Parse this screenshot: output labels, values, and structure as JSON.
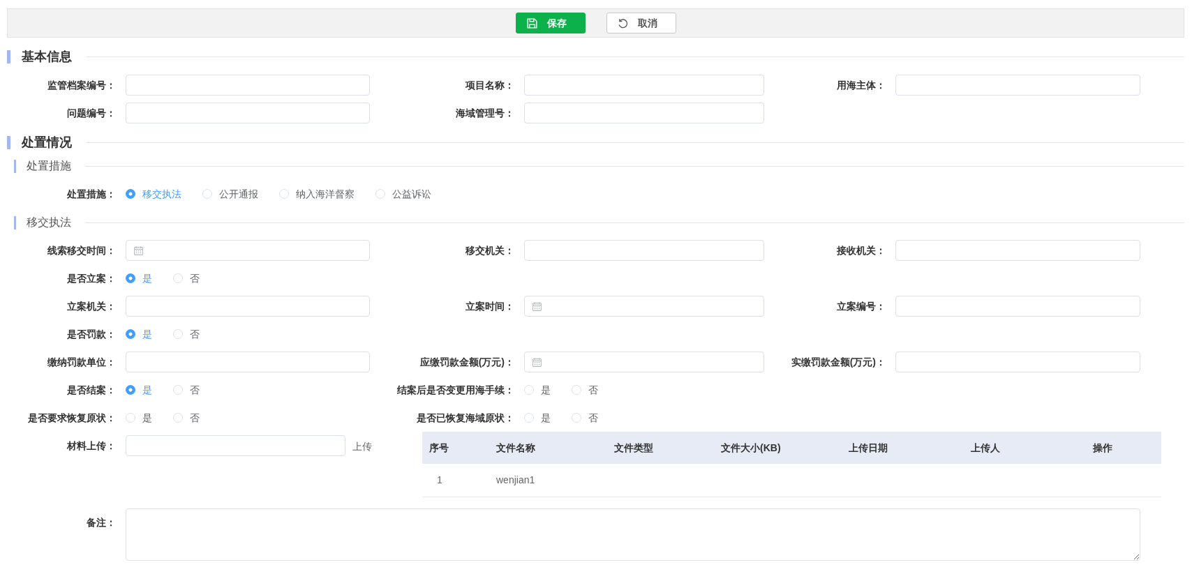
{
  "toolbar": {
    "buttons": [
      {
        "kind": "save",
        "label": "保存"
      },
      {
        "kind": "cancel",
        "label": "取消"
      }
    ]
  },
  "sections": [
    {
      "title": "基本信息",
      "rows": [
        {
          "fields": [
            {
              "kind": "text",
              "label": "监管档案编号："
            },
            {
              "kind": "text",
              "label": "项目名称："
            },
            {
              "kind": "text",
              "label": "用海主体："
            }
          ]
        },
        {
          "fields": [
            {
              "kind": "text",
              "label": "问题编号："
            },
            {
              "kind": "text",
              "label": "海域管理号："
            }
          ]
        }
      ]
    },
    {
      "title": "处置情况",
      "subsections": [
        {
          "title": "处置措施",
          "rows": [
            {
              "fields": [
                {
                  "kind": "radio",
                  "label": "处置措施：",
                  "options": [
                    {
                      "label": "移交执法",
                      "selected": true
                    },
                    {
                      "label": "公开通报",
                      "selected": false
                    },
                    {
                      "label": "纳入海洋督察",
                      "selected": false
                    },
                    {
                      "label": "公益诉讼",
                      "selected": false
                    }
                  ]
                }
              ]
            }
          ]
        },
        {
          "title": "移交执法",
          "rows": [
            {
              "fields": [
                {
                  "kind": "date",
                  "label": "线索移交时间："
                },
                {
                  "kind": "text",
                  "label": "移交机关："
                },
                {
                  "kind": "text",
                  "label": "接收机关："
                }
              ]
            },
            {
              "fields": [
                {
                  "kind": "radio",
                  "label": "是否立案：",
                  "options": [
                    {
                      "label": "是",
                      "selected": true
                    },
                    {
                      "label": "否",
                      "selected": false
                    }
                  ]
                }
              ]
            },
            {
              "fields": [
                {
                  "kind": "text",
                  "label": "立案机关："
                },
                {
                  "kind": "date",
                  "label": "立案时间："
                },
                {
                  "kind": "text",
                  "label": "立案编号："
                }
              ]
            },
            {
              "fields": [
                {
                  "kind": "radio",
                  "label": "是否罚款：",
                  "options": [
                    {
                      "label": "是",
                      "selected": true
                    },
                    {
                      "label": "否",
                      "selected": false
                    }
                  ]
                }
              ]
            },
            {
              "fields": [
                {
                  "kind": "text",
                  "label": "缴纳罚款单位："
                },
                {
                  "kind": "date",
                  "label": "应缴罚款金额(万元)："
                },
                {
                  "kind": "text",
                  "label": "实缴罚款金额(万元)："
                }
              ]
            },
            {
              "fields": [
                {
                  "kind": "radio",
                  "label": "是否结案：",
                  "options": [
                    {
                      "label": "是",
                      "selected": true
                    },
                    {
                      "label": "否",
                      "selected": false
                    }
                  ]
                },
                {
                  "kind": "radio",
                  "label": "结案后是否变更用海手续：",
                  "options": [
                    {
                      "label": "是",
                      "selected": false
                    },
                    {
                      "label": "否",
                      "selected": false
                    }
                  ]
                }
              ]
            },
            {
              "fields": [
                {
                  "kind": "radio",
                  "label": "是否要求恢复原状：",
                  "options": [
                    {
                      "label": "是",
                      "selected": false
                    },
                    {
                      "label": "否",
                      "selected": false
                    }
                  ]
                },
                {
                  "kind": "radio",
                  "label": "是否已恢复海域原状：",
                  "options": [
                    {
                      "label": "是",
                      "selected": false
                    },
                    {
                      "label": "否",
                      "selected": false
                    }
                  ]
                }
              ]
            },
            {
              "fields": [
                {
                  "kind": "upload",
                  "label": "材料上传：",
                  "action": "上传",
                  "files": {
                    "columns": [
                      "序号",
                      "文件名称",
                      "文件类型",
                      "文件大小(KB)",
                      "上传日期",
                      "上传人",
                      "操作"
                    ],
                    "rows": [
                      [
                        "1",
                        "wenjian1"
                      ]
                    ]
                  }
                }
              ]
            },
            {
              "fields": [
                {
                  "kind": "textarea",
                  "label": "备注："
                }
              ]
            }
          ]
        }
      ]
    }
  ]
}
